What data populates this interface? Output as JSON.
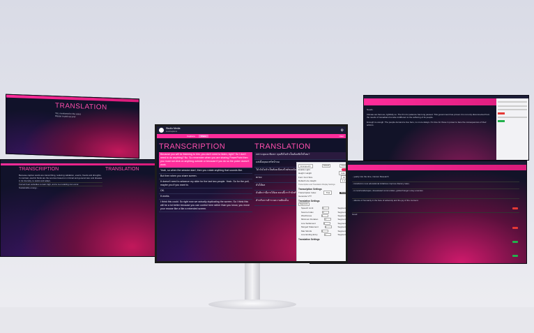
{
  "main": {
    "brand": "Studio Media",
    "brand_sub": "LiveCaptions",
    "tabs": [
      "Captions",
      "Share"
    ],
    "transcription_title": "TRANSCRIPTION",
    "translation_title": "TRANSLATION",
    "user_label": "User",
    "transcription_lines": [
      "Because you will be listening to him, you don't need to listen, right? So I don't need to do anything? No. So remember when you are sharing PowerPoint then you must not click on anything outside or because if you do so the poker doesn't work.",
      "Yeah, so when the session start, then you rotate anything that sounds like.",
      "But then when you share screen.",
      "It doesn't need to advance my slide for the last two people. Yeah. So for the poll, maybe you if you want to.",
      "OK.",
      "It works.",
      "I think this could. So right now we actually duplicating the screen. So I think this will be a lot better because you can control here rather than you know, you move your mouse like a like a extended screen."
    ],
    "translation_lines": [
      "เพราะคุณจะฟังเขา คุณจึงไม่จำเป็นต้องฟังใช่ไหม?",
      "แต่เมื่อคุณแชร์หน้าจอ",
      "โอ้ มันไม่จำเป็นต้องเลื่อนสไลด์ของฉัน",
      "ตกลง",
      "มันได้ผล",
      "ฉันคิดว่านี่อาจได้ผล ตอนนี้เรากำลังทำซ้ำหน้าจอ",
      "สำหรับการสำรวจความคิดเห็น"
    ]
  },
  "popup": {
    "language": "Ensiopeshi",
    "default_label": "Default",
    "close_label": "Close",
    "rows": [
      "Enable Light",
      "Height: Height",
      "Font: Font Size",
      "Default Line Height",
      "Transcription and Translation Display Settings"
    ],
    "height_value": "Auto",
    "font_value": "12",
    "line_value": "1.4",
    "transcription_settings": "Transcription Settings",
    "transcription_label": "Transcription Index",
    "transcription_value": "Thai",
    "reset_label": "Reset",
    "auto_label": "Generate VTT",
    "translation_settings": "Translation Settings",
    "segments_label": "Segments",
    "segment_rows": [
      {
        "name": "Speech Limit",
        "value": "3"
      },
      {
        "name": "Source Index",
        "value": "2"
      },
      {
        "name": "Word/Lines",
        "value": "2"
      },
      {
        "name": "Minimum Duration",
        "value": "2"
      },
      {
        "name": "Line Settlement",
        "value": "2"
      },
      {
        "name": "Merged Statement",
        "value": "2"
      },
      {
        "name": "Max Words",
        "value": "2"
      },
      {
        "name": "Line Ending Entry",
        "value": "2"
      }
    ],
    "translation_settings_footer": "Translation Settings"
  },
  "left_top": {
    "title": "TRANSLATION",
    "lines": [
      "Yes, mentioned to the users",
      "Please to pick up your"
    ]
  },
  "left_bottom": {
    "transcription_title": "TRANSCRIPTION",
    "translation_title": "TRANSLATION",
    "lines": [
      "Because captive words are transcribing, reducing validation, events, floods and droughts. In contrast, electric fluids are the sources based on minimal and general care and disease in its intensity, to assist and adapt,",
      "Forced Fuel subsidies remain high, and a re-modeling can occur.",
      "Sustainable energy...",
      "Greenhouse gas to your regulation...",
      "Good"
    ]
  },
  "right_top": {
    "lines": [
      "Needs.",
      "Climate are famous, rightfully so. The firm for patience has long passed. This government has proven it is not only disconnected from the needs of Canadians but also indifferent to the suffering of its people.",
      "Enough is enough. The people demand a true hero, no more delays. It's time for those in power to face the consequences of their actions."
    ]
  },
  "right_bottom": {
    "lines": [
      "...yearly into the time, Cancer Research",
      "...transforms new educational initiatives improve literacy rates.",
      "...in rural landscapes, devastated communities, global hunger a key enemies",
      "...silence of humanity in the face of adversity and the joy of the moment.",
      "Good"
    ]
  }
}
